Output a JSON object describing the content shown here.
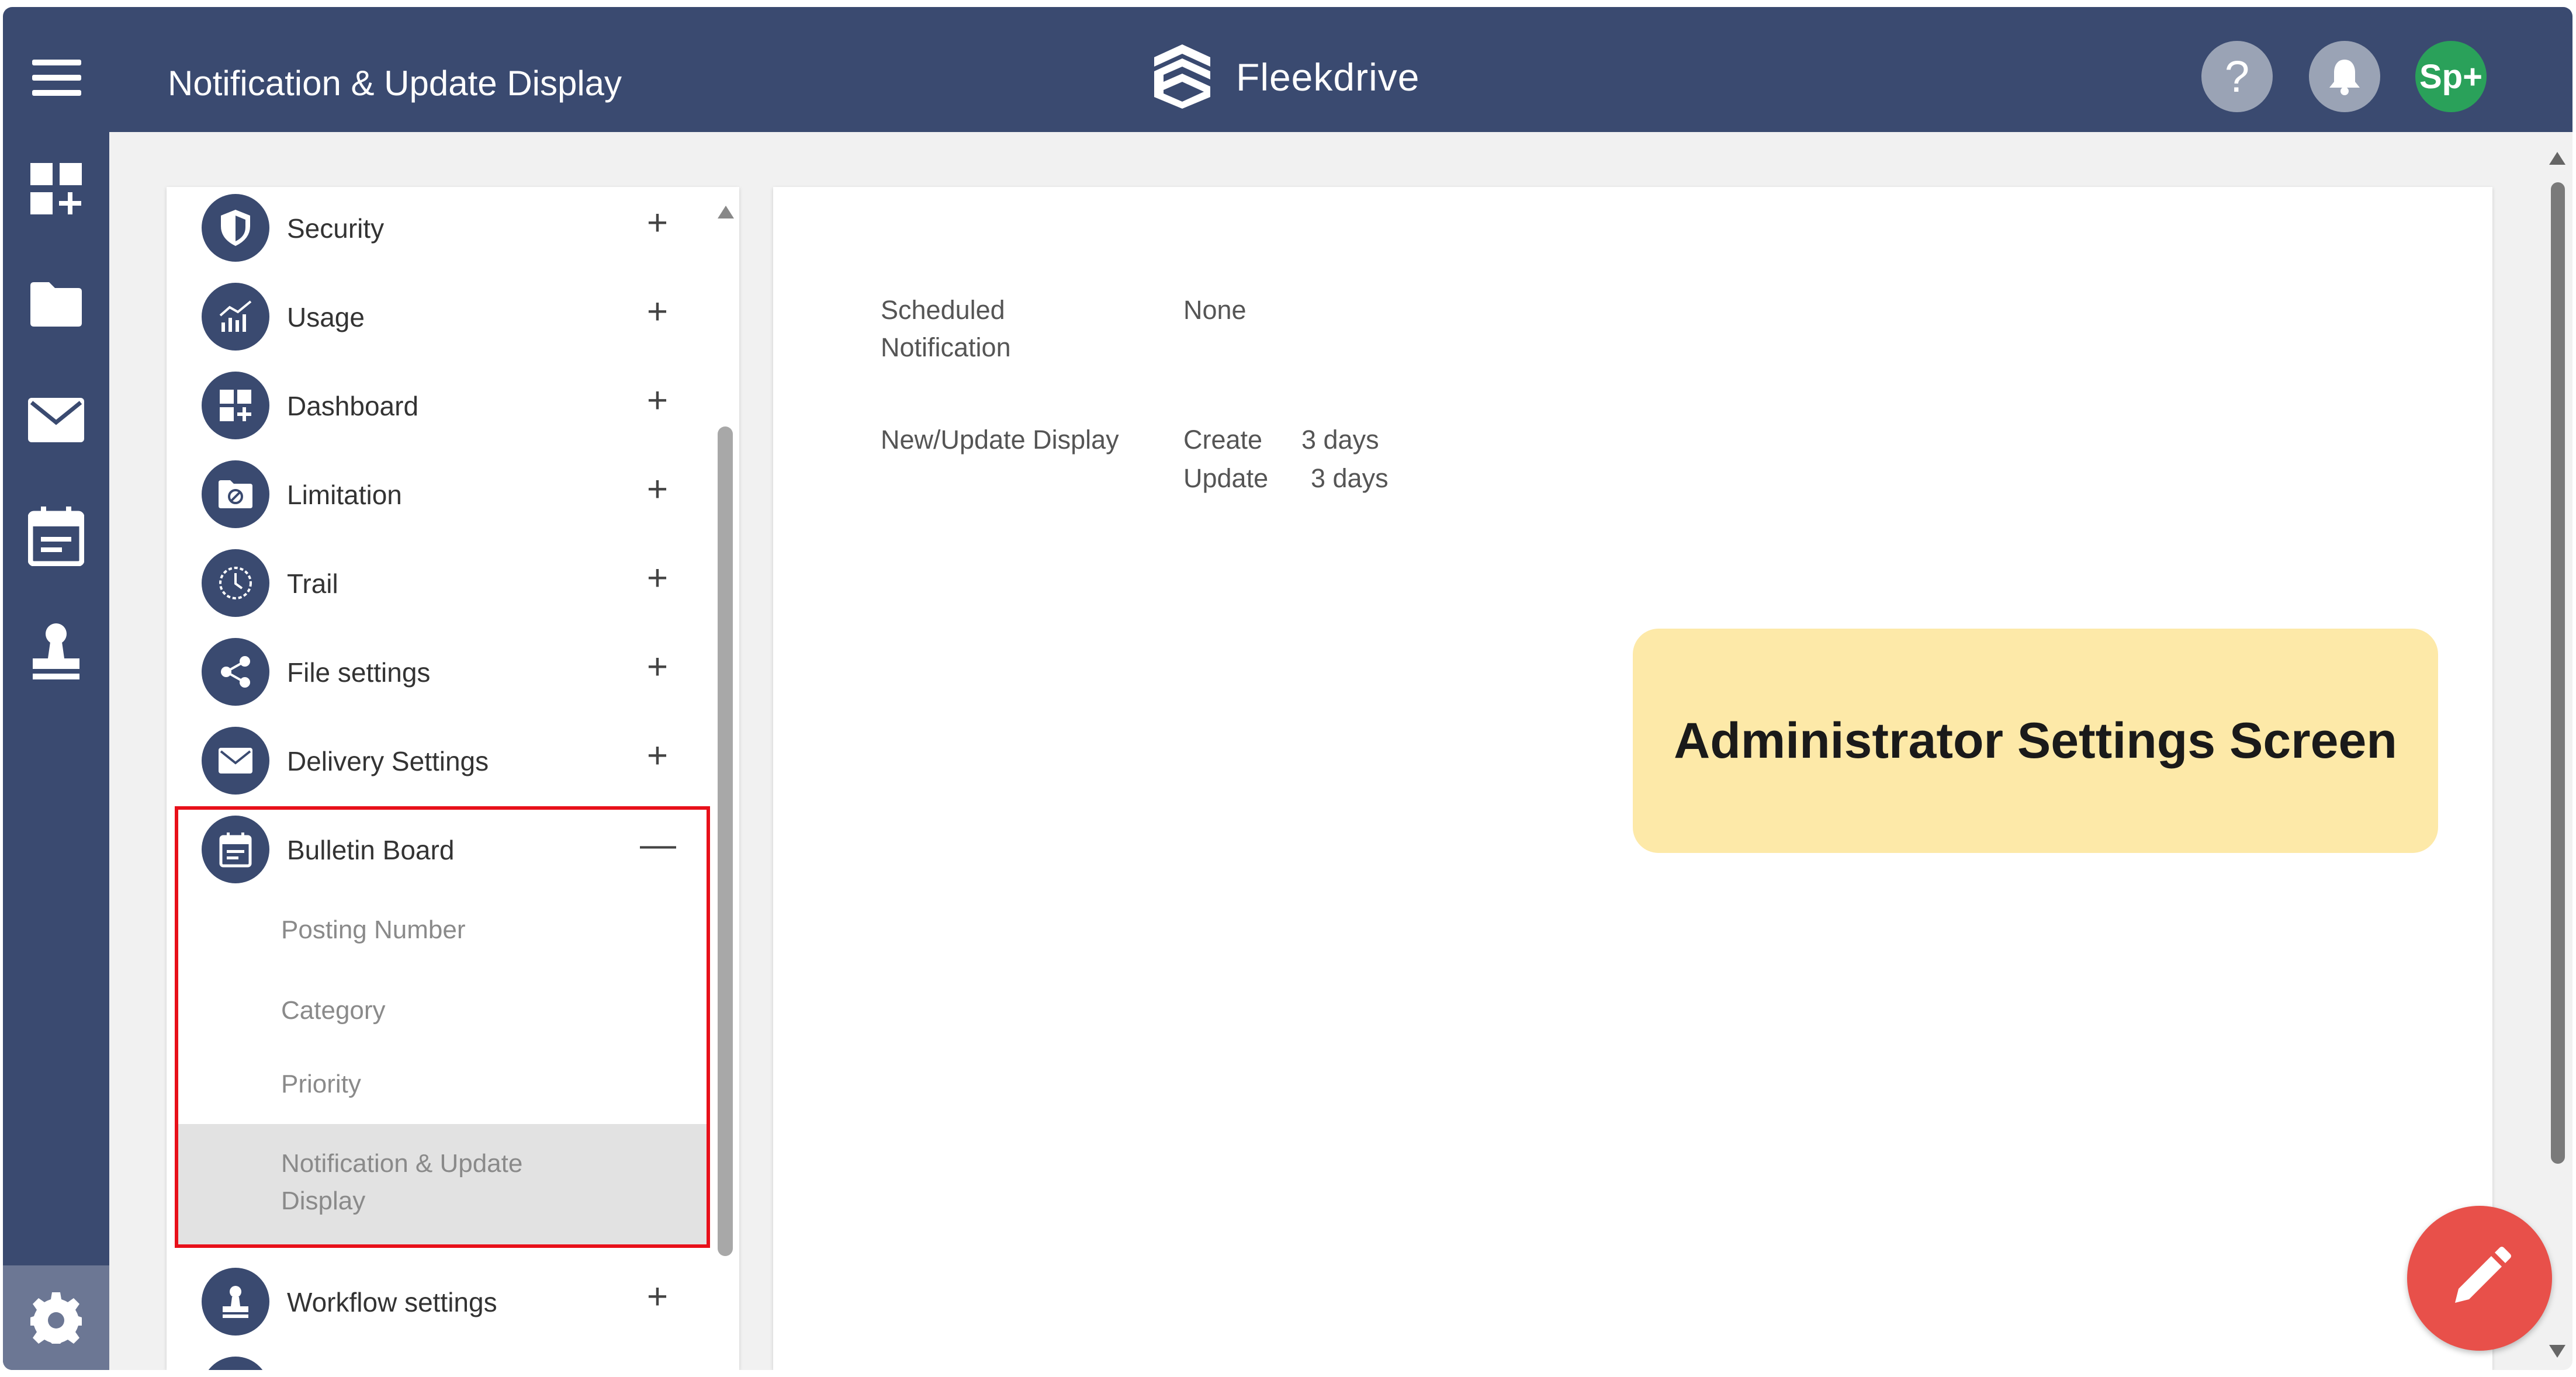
{
  "header": {
    "title": "Notification & Update Display",
    "brand": "Fleekdrive",
    "help_label": "?",
    "avatar_label": "Sp+"
  },
  "rail": {
    "icons": [
      "dashboard-add-icon",
      "folder-icon",
      "mail-icon",
      "calendar-icon",
      "stamp-icon",
      "gear-icon"
    ]
  },
  "nav": {
    "items": [
      {
        "label": "Security",
        "icon": "shield-icon",
        "toggle": "+"
      },
      {
        "label": "Usage",
        "icon": "chart-icon",
        "toggle": "+"
      },
      {
        "label": "Dashboard",
        "icon": "dashboard-icon",
        "toggle": "+"
      },
      {
        "label": "Limitation",
        "icon": "folder-block-icon",
        "toggle": "+"
      },
      {
        "label": "Trail",
        "icon": "clock-icon",
        "toggle": "+"
      },
      {
        "label": "File settings",
        "icon": "share-icon",
        "toggle": "+"
      },
      {
        "label": "Delivery Settings",
        "icon": "mail-icon",
        "toggle": "+"
      },
      {
        "label": "Bulletin Board",
        "icon": "calendar-icon",
        "toggle": "—"
      },
      {
        "label": "Workflow settings",
        "icon": "stamp-icon",
        "toggle": "+"
      }
    ],
    "bulletin_sub": [
      {
        "label": "Posting Number"
      },
      {
        "label": "Category"
      },
      {
        "label": "Priority"
      },
      {
        "label": "Notification & Update Display",
        "active": true
      }
    ]
  },
  "content": {
    "scheduled_label": "Scheduled Notification",
    "scheduled_label_line1": "Scheduled",
    "scheduled_label_line2": "Notification",
    "scheduled_value": "None",
    "newupdate_label": "New/Update Display",
    "create_label": "Create",
    "create_value": "3 days",
    "update_label": "Update",
    "update_value": "3 days"
  },
  "callout": {
    "text": "Administrator Settings Screen"
  },
  "colors": {
    "header_bg": "#3a4a70",
    "highlight": "#e8101a",
    "callout_bg": "#fde9a8",
    "fab": "#e8504a",
    "avatar": "#2aa15a"
  }
}
